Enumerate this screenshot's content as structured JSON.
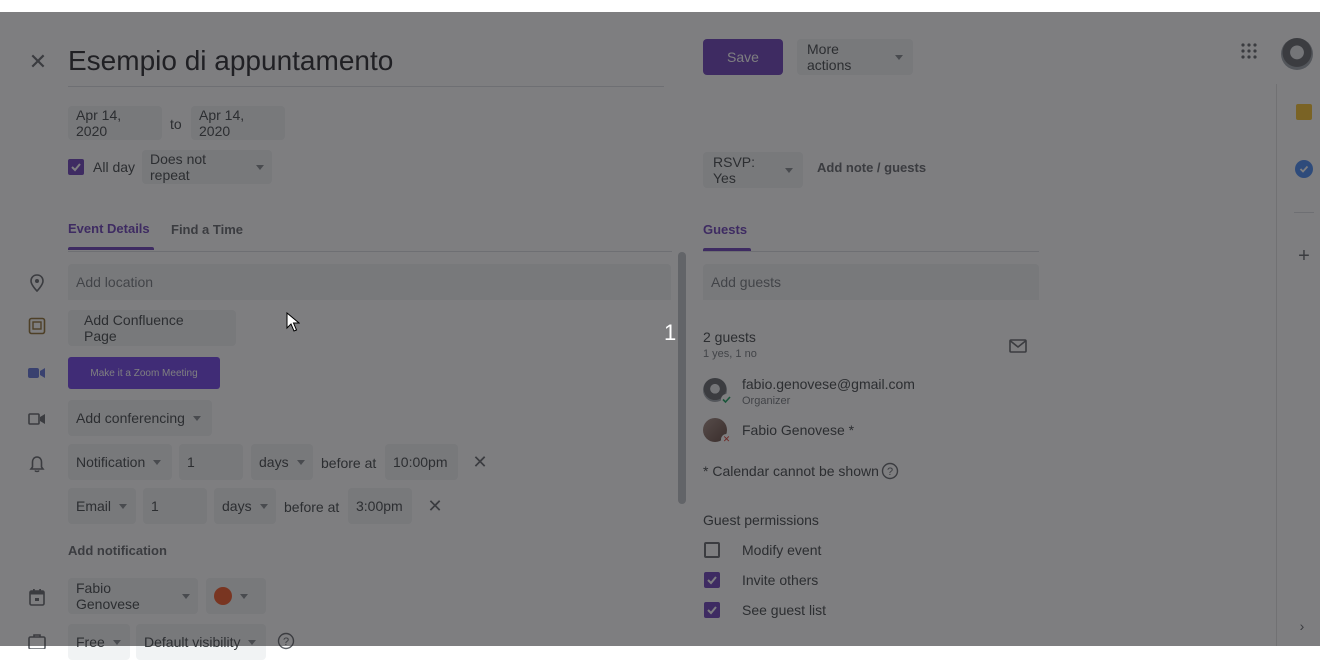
{
  "title": "Esempio di appuntamento",
  "header": {
    "save_label": "Save",
    "more_actions_label": "More actions"
  },
  "dates": {
    "start": "Apr 14, 2020",
    "to": "to",
    "end": "Apr 14, 2020"
  },
  "allday": {
    "label": "All day",
    "repeat": "Does not repeat"
  },
  "tabs": {
    "details": "Event Details",
    "find_time": "Find a Time"
  },
  "location": {
    "placeholder": "Add location"
  },
  "confluence": {
    "label": "Add Confluence Page"
  },
  "zoom": {
    "label": "Make it a Zoom Meeting"
  },
  "conferencing": {
    "label": "Add conferencing"
  },
  "notifications": [
    {
      "type": "Notification",
      "amount": "1",
      "unit": "days",
      "before_at": "before at",
      "time": "10:00pm"
    },
    {
      "type": "Email",
      "amount": "1",
      "unit": "days",
      "before_at": "before at",
      "time": "3:00pm"
    }
  ],
  "add_notification": "Add notification",
  "calendar_owner": "Fabio Genovese",
  "availability": {
    "status": "Free",
    "visibility": "Default visibility"
  },
  "rsvp": {
    "label": "RSVP: Yes",
    "add_note": "Add note / guests"
  },
  "guests": {
    "tab": "Guests",
    "add_placeholder": "Add guests",
    "count": "2 guests",
    "summary": "1 yes, 1 no",
    "list": [
      {
        "name": "fabio.genovese@gmail.com",
        "role": "Organizer"
      },
      {
        "name": "Fabio Genovese *",
        "role": ""
      }
    ],
    "calendar_note": "* Calendar cannot be shown"
  },
  "permissions": {
    "title": "Guest permissions",
    "items": [
      {
        "label": "Modify event",
        "checked": false
      },
      {
        "label": "Invite others",
        "checked": true
      },
      {
        "label": "See guest list",
        "checked": true
      }
    ]
  },
  "step_marker": "1",
  "colors": {
    "accent": "#673ab7",
    "primary_text": "#3c4043",
    "secondary_text": "#70757a"
  }
}
